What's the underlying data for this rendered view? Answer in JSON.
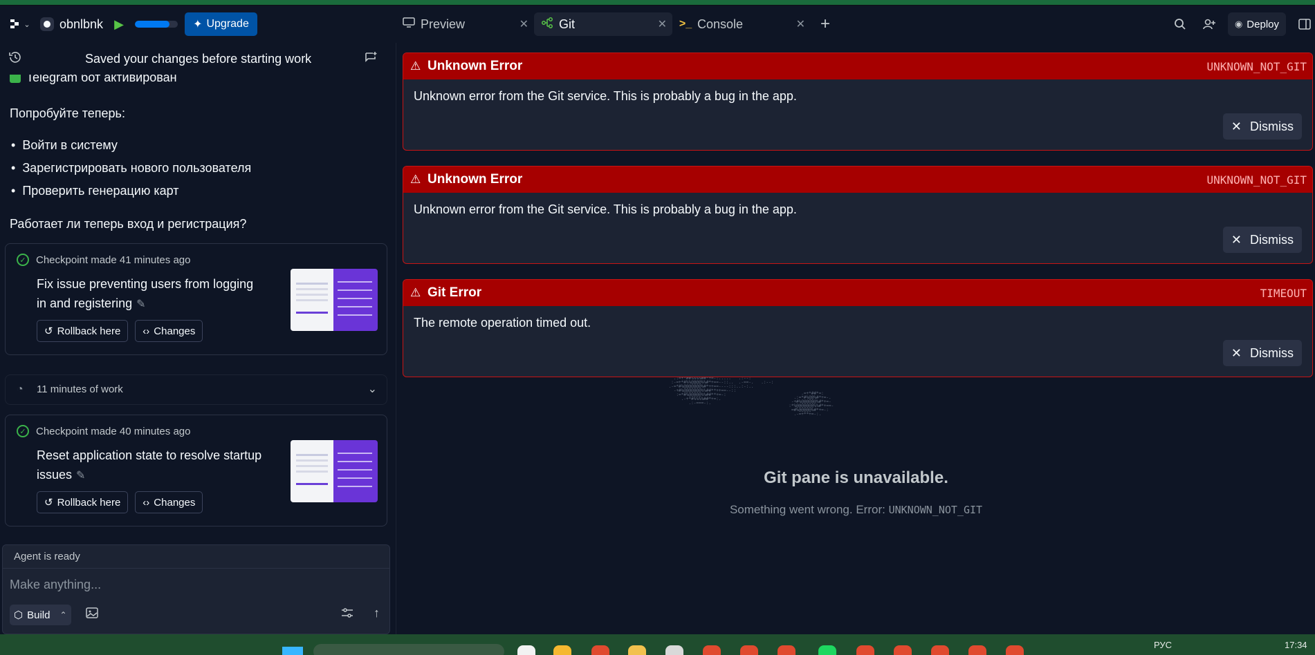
{
  "header": {
    "project_name": "obnlbnk",
    "upgrade_label": "Upgrade",
    "deploy_label": "Deploy",
    "progress_fraction": 0.8,
    "tabs": [
      {
        "label": "Preview",
        "icon": "monitor-icon"
      },
      {
        "label": "Git",
        "icon": "git-branch-icon"
      },
      {
        "label": "Console",
        "icon": "terminal-icon"
      }
    ]
  },
  "left_panel": {
    "status_text": "Saved your changes before starting work",
    "cut_line": "Telegram бот активирован",
    "try_now": "Попробуйте теперь:",
    "bullets": [
      "Войти в систему",
      "Зарегистрировать нового пользователя",
      "Проверить генерацию карт"
    ],
    "question": "Работает ли теперь вход и регистрация?",
    "checkpoints": [
      {
        "meta": "Checkpoint made 41 minutes ago",
        "title": "Fix issue preventing users from logging in and registering",
        "rollback_label": "Rollback here",
        "changes_label": "Changes"
      },
      {
        "meta": "Checkpoint made 40 minutes ago",
        "title": "Reset application state to resolve startup issues",
        "rollback_label": "Rollback here",
        "changes_label": "Changes"
      }
    ],
    "work_summary": "11 minutes of work",
    "composer": {
      "status": "Agent is ready",
      "placeholder": "Make anything...",
      "mode_label": "Build"
    }
  },
  "git_pane": {
    "errors": [
      {
        "title": "Unknown Error",
        "code": "UNKNOWN_NOT_GIT",
        "message": "Unknown error from the Git service. This is probably a bug in the app.",
        "dismiss_label": "Dismiss"
      },
      {
        "title": "Unknown Error",
        "code": "UNKNOWN_NOT_GIT",
        "message": "Unknown error from the Git service. This is probably a bug in the app.",
        "dismiss_label": "Dismiss"
      },
      {
        "title": "Git Error",
        "code": "TIMEOUT",
        "message": "The remote operation timed out.",
        "dismiss_label": "Dismiss"
      }
    ],
    "empty_title": "Git pane is unavailable.",
    "empty_sub": "Something went wrong. Error:",
    "empty_code": "UNKNOWN_NOT_GIT"
  },
  "taskbar": {
    "language": "РУС",
    "time": "17:34"
  },
  "colors": {
    "background": "#0e1525",
    "surface": "#1c2333",
    "error_header": "#a60000",
    "accent_blue": "#0053a6",
    "success_green": "#3bb34a"
  }
}
